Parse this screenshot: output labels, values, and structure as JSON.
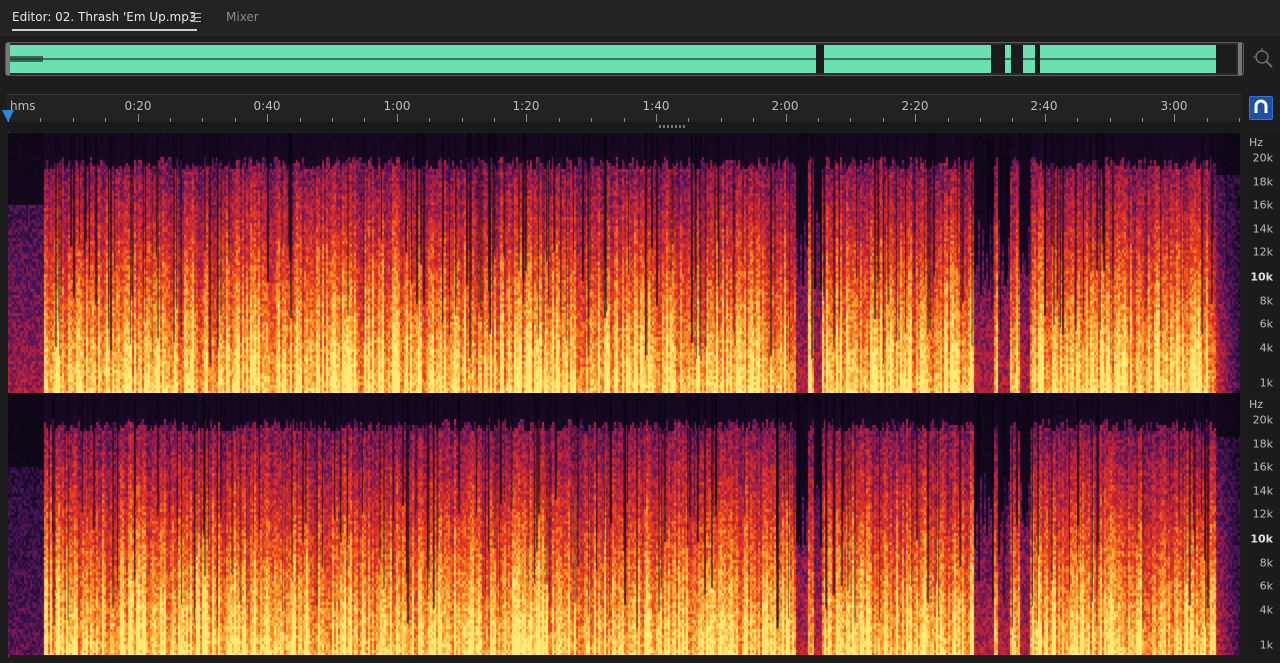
{
  "tabs": {
    "editor": "Editor: 02. Thrash 'Em Up.mp3",
    "mixer": "Mixer"
  },
  "icons": {
    "menu": "hamburger-menu-icon",
    "zoom": "zoom-navigator-icon",
    "snap": "snap-magnet-icon"
  },
  "ruler": {
    "unit_label": "hms",
    "labels": [
      "0:20",
      "0:40",
      "1:00",
      "1:20",
      "1:40",
      "2:00",
      "2:20",
      "2:40",
      "3:00"
    ]
  },
  "frequency_scale": {
    "unit": "Hz",
    "labels": [
      "20k",
      "18k",
      "16k",
      "14k",
      "12k",
      "10k",
      "8k",
      "6k",
      "4k",
      "1k"
    ],
    "emphasized": "10k"
  },
  "colors": {
    "overview_waveform": "#6be0b0",
    "playhead": "#2e86de",
    "spectral_low": "#ffe071",
    "spectral_mid": "#e6391f",
    "spectral_high": "#6b1f6e",
    "background": "#1d1d1d"
  }
}
